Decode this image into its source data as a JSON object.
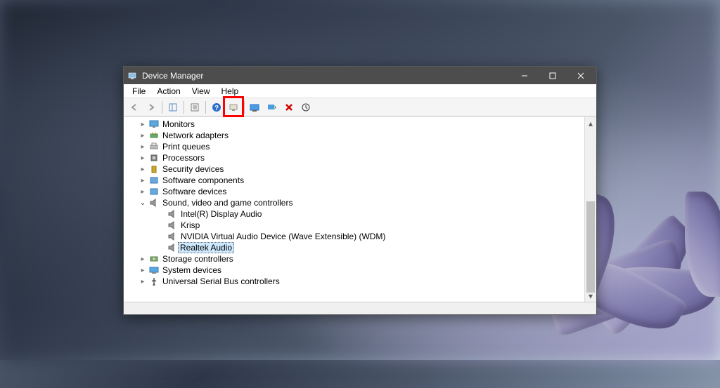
{
  "title": "Device Manager",
  "menu": {
    "file": "File",
    "action": "Action",
    "view": "View",
    "help": "Help"
  },
  "tree": {
    "monitors": "Monitors",
    "network": "Network adapters",
    "printq": "Print queues",
    "processors": "Processors",
    "security": "Security devices",
    "swcomp": "Software components",
    "swdev": "Software devices",
    "sound": "Sound, video and game controllers",
    "sound_children": {
      "intel": "Intel(R) Display Audio",
      "krisp": "Krisp",
      "nvidia": "NVIDIA Virtual Audio Device (Wave Extensible) (WDM)",
      "realtek": "Realtek Audio"
    },
    "storage": "Storage controllers",
    "sysdev": "System devices",
    "usb": "Universal Serial Bus controllers"
  }
}
